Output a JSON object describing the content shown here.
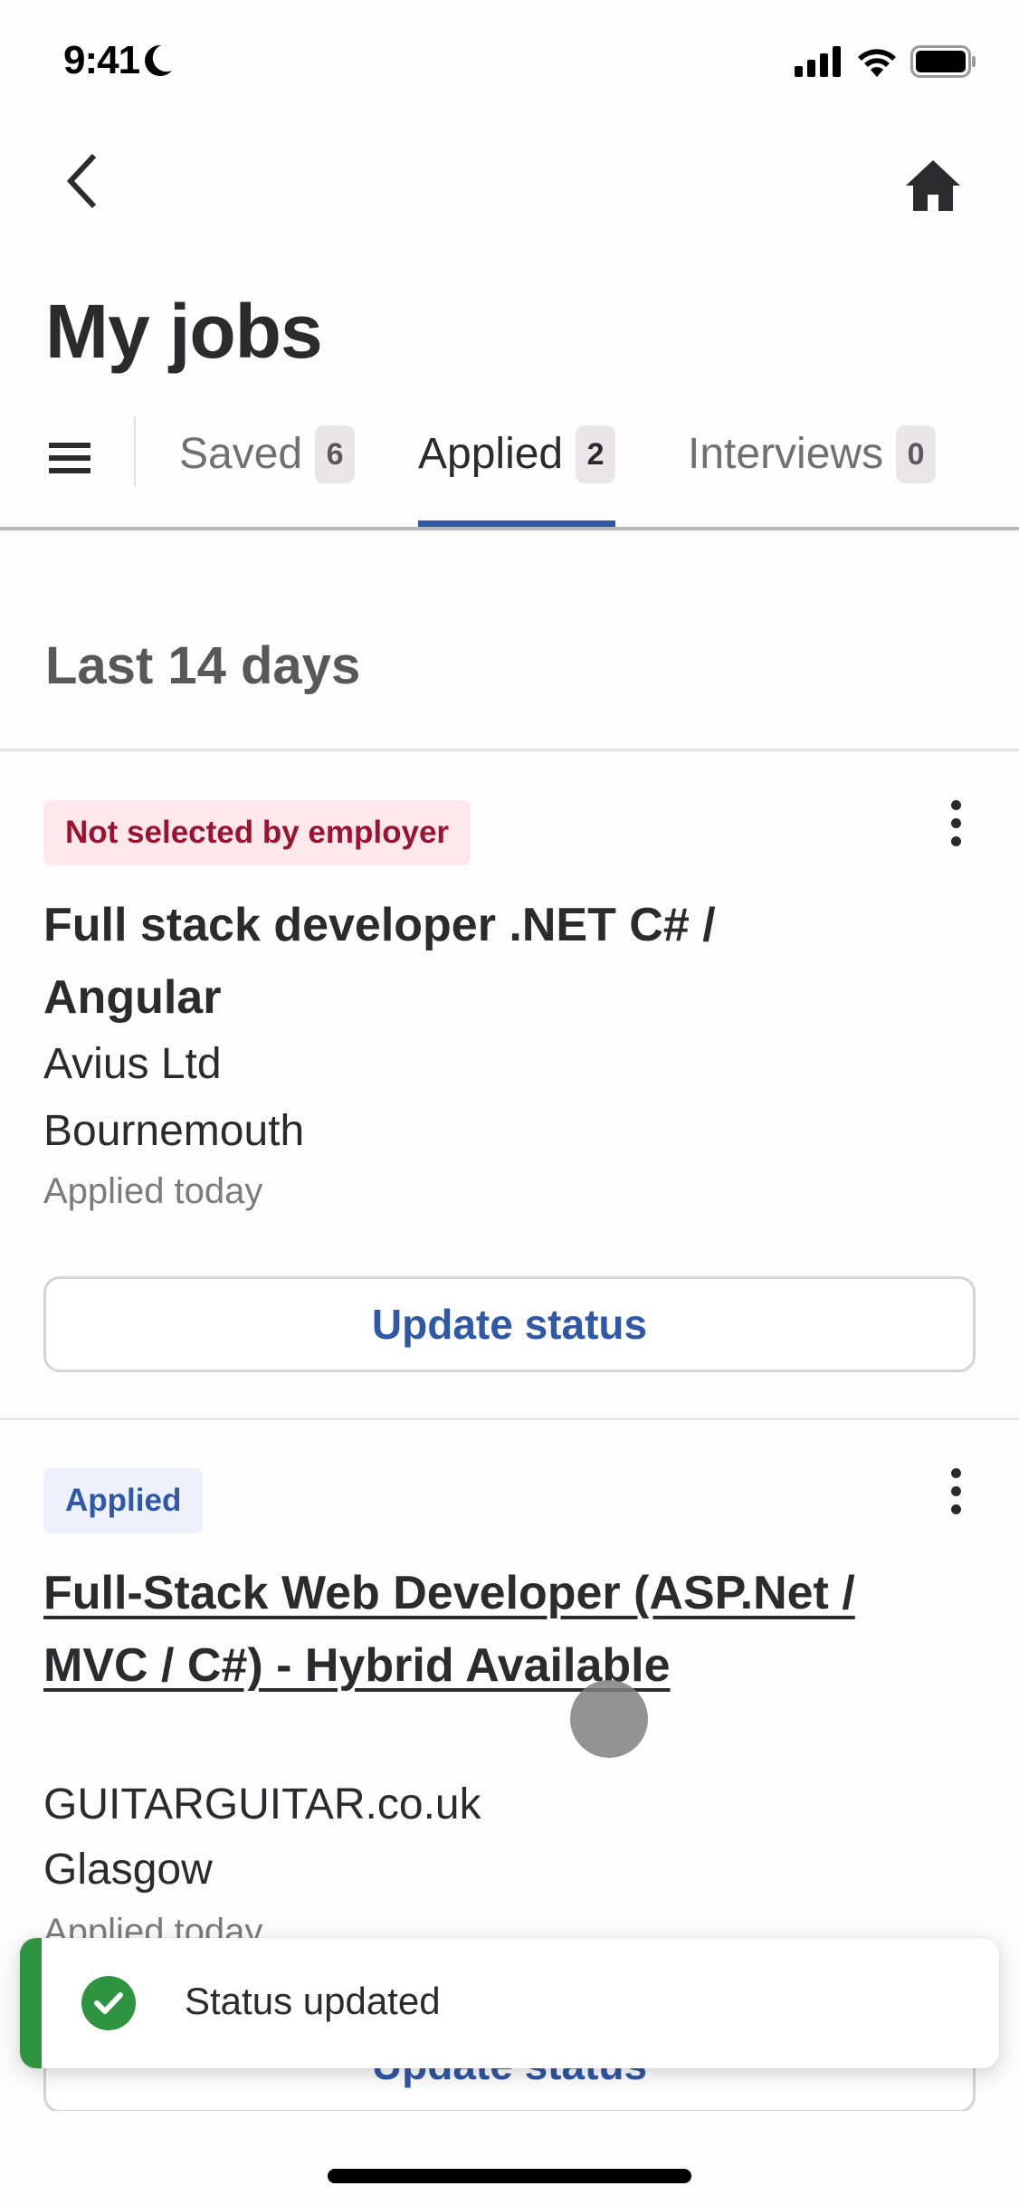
{
  "status_bar": {
    "time": "9:41",
    "focus_icon": "moon-icon",
    "signal_icon": "cellular-signal-icon",
    "wifi_icon": "wifi-icon",
    "battery_icon": "battery-icon"
  },
  "nav": {
    "back_icon": "chevron-left-icon",
    "home_icon": "home-icon"
  },
  "page": {
    "title": "My jobs"
  },
  "tabs": {
    "menu_icon": "hamburger-menu-icon",
    "active": "Applied",
    "items": [
      {
        "label": "Saved",
        "count": "6"
      },
      {
        "label": "Applied",
        "count": "2"
      },
      {
        "label": "Interviews",
        "count": "0"
      }
    ]
  },
  "section": {
    "heading": "Last 14 days"
  },
  "jobs": [
    {
      "status": "Not selected by employer",
      "title": "Full stack developer .NET C# / Angular",
      "company": "Avius Ltd",
      "location": "Bournemouth",
      "applied": "Applied today",
      "action": "Update status"
    },
    {
      "status": "Applied",
      "title": "Full-Stack Web Developer (ASP.Net / MVC / C#) - Hybrid Available",
      "company": "GUITARGUITAR.co.uk",
      "location": "Glasgow",
      "applied": "Applied today",
      "action": "Update status"
    }
  ],
  "toast": {
    "icon": "check-circle-icon",
    "message": "Status updated"
  },
  "colors": {
    "accent": "#2f58a6",
    "rejected_text": "#9b1331",
    "rejected_bg": "#fde9ec",
    "success": "#2e9440"
  }
}
